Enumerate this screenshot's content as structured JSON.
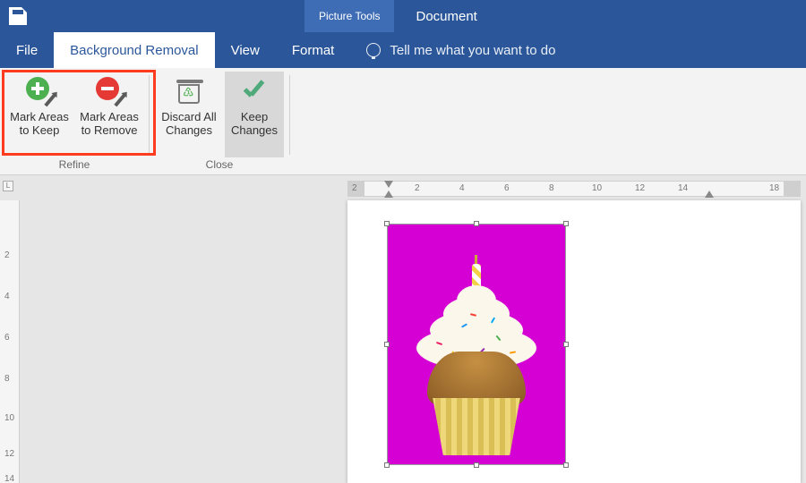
{
  "titlebar": {
    "tool_tab": "Picture Tools",
    "doc_title": "Document"
  },
  "tabs": {
    "file": "File",
    "bg_removal": "Background Removal",
    "view": "View",
    "format": "Format",
    "tellme": "Tell me what you want to do"
  },
  "ribbon": {
    "refine": {
      "label": "Refine",
      "keep": {
        "line1": "Mark Areas",
        "line2": "to Keep"
      },
      "remove": {
        "line1": "Mark Areas",
        "line2": "to Remove"
      }
    },
    "close": {
      "label": "Close",
      "discard": {
        "line1": "Discard All",
        "line2": "Changes"
      },
      "keep": {
        "line1": "Keep",
        "line2": "Changes"
      }
    }
  },
  "ruler": {
    "corner": "L",
    "h": [
      "2",
      "2",
      "4",
      "6",
      "8",
      "10",
      "12",
      "14",
      "18"
    ],
    "v": [
      "2",
      "4",
      "6",
      "8",
      "10",
      "12",
      "14"
    ]
  },
  "colors": {
    "accent": "#2b579a",
    "highlight": "#ff3b1f",
    "removal_mask": "#d400d4"
  }
}
